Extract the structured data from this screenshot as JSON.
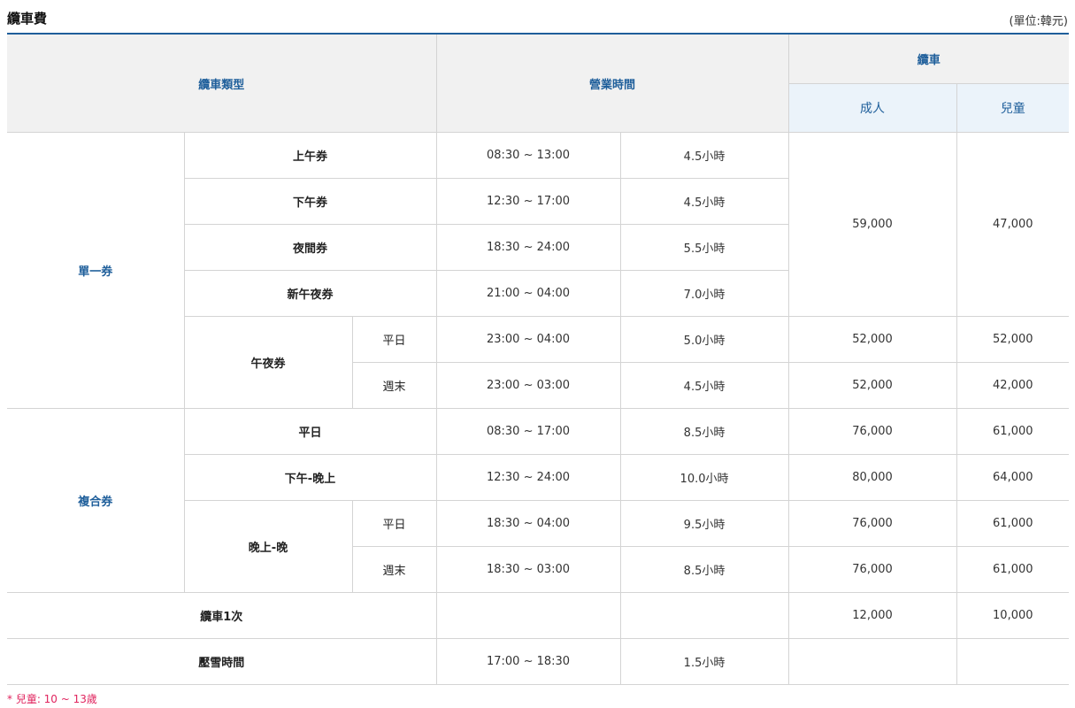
{
  "title": "纜車費",
  "unit": "(單位:韓元)",
  "headers": {
    "type": "纜車類型",
    "hours": "營業時間",
    "cable": "纜車",
    "adult": "成人",
    "child": "兒童"
  },
  "groups": {
    "single": "單一券",
    "combo": "複合券"
  },
  "single_rows": [
    {
      "label": "上午券",
      "time": "08:30 ~ 13:00",
      "duration": "4.5小時"
    },
    {
      "label": "下午券",
      "time": "12:30 ~ 17:00",
      "duration": "4.5小時"
    },
    {
      "label": "夜間券",
      "time": "18:30 ~ 24:00",
      "duration": "5.5小時"
    },
    {
      "label": "新午夜券",
      "time": "21:00 ~ 04:00",
      "duration": "7.0小時"
    }
  ],
  "single_shared_price": {
    "adult": "59,000",
    "child": "47,000"
  },
  "midnight": {
    "label": "午夜券",
    "rows": [
      {
        "sub": "平日",
        "time": "23:00 ~ 04:00",
        "duration": "5.0小時",
        "adult": "52,000",
        "child": "52,000"
      },
      {
        "sub": "週末",
        "time": "23:00 ~ 03:00",
        "duration": "4.5小時",
        "adult": "52,000",
        "child": "42,000"
      }
    ]
  },
  "combo_rows": [
    {
      "label": "平日",
      "time": "08:30 ~ 17:00",
      "duration": "8.5小時",
      "adult": "76,000",
      "child": "61,000"
    },
    {
      "label": "下午-晚上",
      "time": "12:30 ~ 24:00",
      "duration": "10.0小時",
      "adult": "80,000",
      "child": "64,000"
    }
  ],
  "evening": {
    "label": "晚上-晚",
    "rows": [
      {
        "sub": "平日",
        "time": "18:30 ~ 04:00",
        "duration": "9.5小時",
        "adult": "76,000",
        "child": "61,000"
      },
      {
        "sub": "週末",
        "time": "18:30 ~ 03:00",
        "duration": "8.5小時",
        "adult": "76,000",
        "child": "61,000"
      }
    ]
  },
  "one_ride": {
    "label": "纜車1次",
    "adult": "12,000",
    "child": "10,000"
  },
  "snow": {
    "label": "壓雪時間",
    "time": "17:00 ~ 18:30",
    "duration": "1.5小時"
  },
  "note": "* 兒童: 10 ~ 13歲",
  "colors": {
    "accent": "#1f5f9b",
    "note": "#e0245e",
    "header_bg": "#f1f1f1",
    "subheader_bg": "#ebf3fa"
  }
}
